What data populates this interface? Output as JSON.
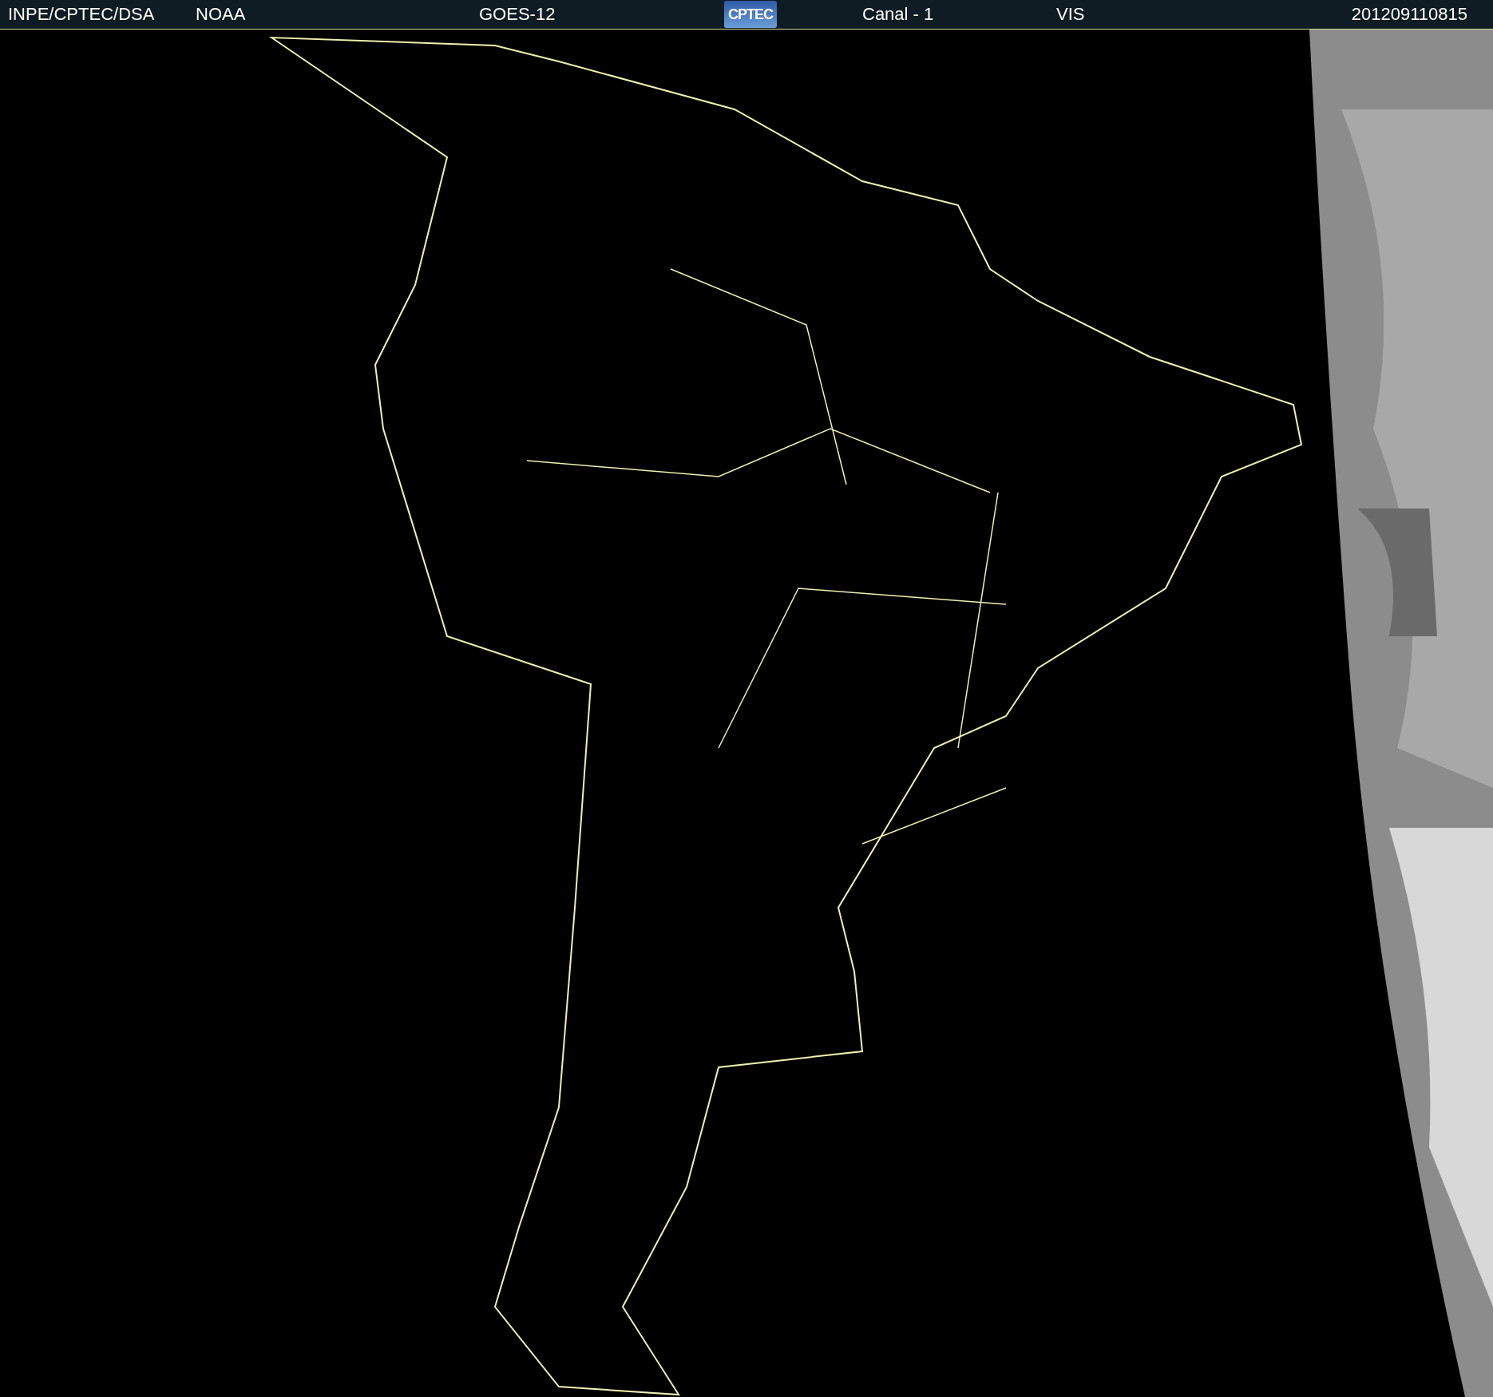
{
  "header": {
    "source": "INPE/CPTEC/DSA",
    "agency": "NOAA",
    "satellite": "GOES-12",
    "logo": "CPTEC",
    "channel": "Canal - 1",
    "band": "VIS",
    "timestamp": "201209110815"
  }
}
